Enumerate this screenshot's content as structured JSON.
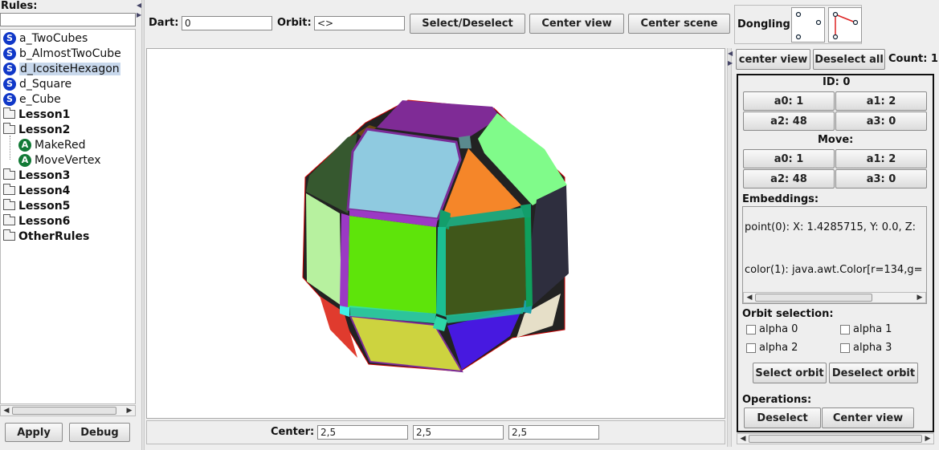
{
  "left_panel": {
    "title": "Rules:",
    "search_value": "",
    "tree": [
      {
        "label": "a_TwoCubes",
        "kind": "rule"
      },
      {
        "label": "b_AlmostTwoCube",
        "kind": "rule"
      },
      {
        "label": "d_IcositeHexagon",
        "kind": "rule",
        "selected": true
      },
      {
        "label": "d_Square",
        "kind": "rule"
      },
      {
        "label": "e_Cube",
        "kind": "rule"
      },
      {
        "label": "Lesson1",
        "kind": "folder"
      },
      {
        "label": "Lesson2",
        "kind": "folder"
      },
      {
        "label": "MakeRed",
        "kind": "action"
      },
      {
        "label": "MoveVertex",
        "kind": "action"
      },
      {
        "label": "Lesson3",
        "kind": "folder"
      },
      {
        "label": "Lesson4",
        "kind": "folder"
      },
      {
        "label": "Lesson5",
        "kind": "folder"
      },
      {
        "label": "Lesson6",
        "kind": "folder"
      },
      {
        "label": "OtherRules",
        "kind": "folder"
      }
    ],
    "apply_label": "Apply",
    "debug_label": "Debug"
  },
  "toolbar": {
    "dart_label": "Dart:",
    "dart_value": "0",
    "orbit_label": "Orbit:",
    "orbit_value": "<>",
    "select_deselect_label": "Select/Deselect",
    "center_view_label": "Center view",
    "center_scene_label": "Center scene",
    "dongling_label": "Dongling:"
  },
  "center_bar": {
    "label": "Center:",
    "x": "2,5",
    "y": "2,5",
    "z": "2,5"
  },
  "right_panel": {
    "center_view_label": "center view",
    "deselect_all_label": "Deselect all",
    "count_label": "Count: 1",
    "id_label": "ID: 0",
    "alphas": [
      "a0: 1",
      "a1: 2",
      "a2: 48",
      "a3: 0"
    ],
    "move_label": "Move:",
    "move_alphas": [
      "a0: 1",
      "a1: 2",
      "a2: 48",
      "a3: 0"
    ],
    "embeddings_label": "Embeddings:",
    "embedding_point": "point(0): X: 1.4285715, Y: 0.0, Z:",
    "embedding_color": "color(1): java.awt.Color[r=134,g=",
    "orbit_selection_label": "Orbit selection:",
    "checkboxes": [
      "alpha 0",
      "alpha 1",
      "alpha 2",
      "alpha 3"
    ],
    "select_orbit_label": "Select orbit",
    "deselect_orbit_label": "Deselect orbit",
    "operations_label": "Operations:",
    "deselect_label": "Deselect",
    "center_view_op_label": "Center view"
  },
  "colors": {
    "accent_rule": "#1038c8",
    "accent_action": "#127a36",
    "selection": "#c8d8ec"
  }
}
